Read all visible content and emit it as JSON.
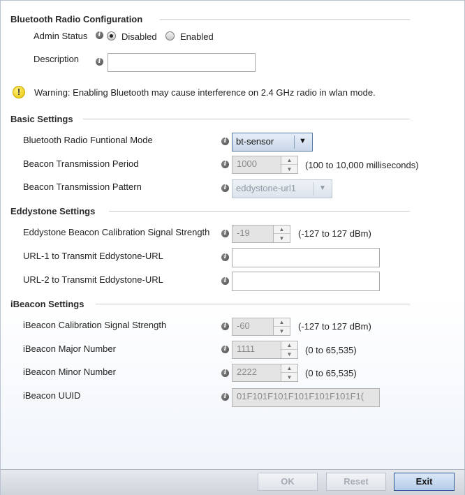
{
  "bluetooth_radio": {
    "section_title": "Bluetooth Radio Configuration",
    "admin_status_label": "Admin Status",
    "admin_status_options": [
      "Disabled",
      "Enabled"
    ],
    "admin_status_selected": "Disabled",
    "description_label": "Description",
    "description_value": ""
  },
  "warning": {
    "icon": "warning-icon",
    "text": "Warning: Enabling Bluetooth may cause interference on 2.4 GHz radio in wlan mode."
  },
  "basic": {
    "section_title": "Basic Settings",
    "mode_label": "Bluetooth Radio Funtional Mode",
    "mode_value": "bt-sensor",
    "period_label": "Beacon Transmission Period",
    "period_value": "1000",
    "period_unit": "(100 to 10,000 milliseconds)",
    "pattern_label": "Beacon Transmission Pattern",
    "pattern_value": "eddystone-url1"
  },
  "eddystone": {
    "section_title": "Eddystone Settings",
    "calibration_label": "Eddystone Beacon Calibration Signal Strength",
    "calibration_value": "-19",
    "calibration_unit": "(-127 to 127 dBm)",
    "url1_label": "URL-1 to Transmit Eddystone-URL",
    "url1_value": "",
    "url2_label": "URL-2 to Transmit Eddystone-URL",
    "url2_value": ""
  },
  "ibeacon": {
    "section_title": "iBeacon Settings",
    "calibration_label": "iBeacon Calibration Signal Strength",
    "calibration_value": "-60",
    "calibration_unit": "(-127 to 127 dBm)",
    "major_label": "iBeacon Major Number",
    "major_value": "1111",
    "major_unit": "(0 to 65,535)",
    "minor_label": "iBeacon Minor Number",
    "minor_value": "2222",
    "minor_unit": "(0 to 65,535)",
    "uuid_label": "iBeacon UUID",
    "uuid_value": "01F101F101F101F101F101F1("
  },
  "footer": {
    "ok_label": "OK",
    "reset_label": "Reset",
    "exit_label": "Exit"
  },
  "colors": {
    "primary_button_border": "#2b5597",
    "warning_yellow": "#e8c300"
  }
}
